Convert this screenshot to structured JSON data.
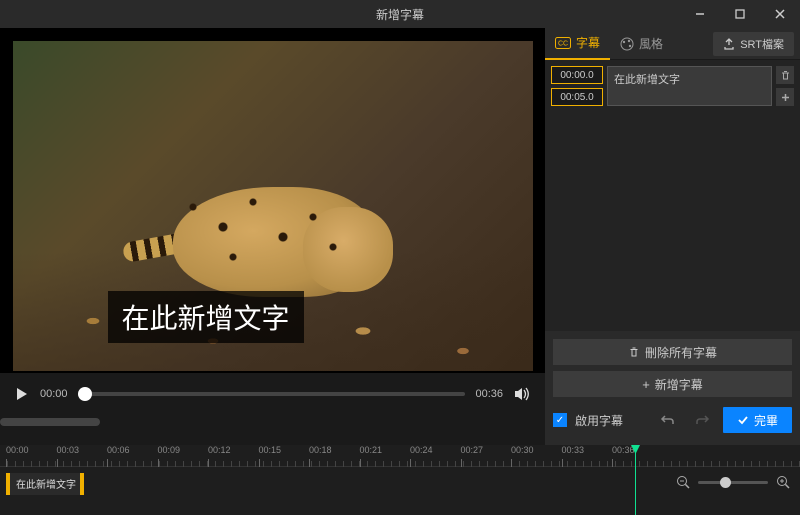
{
  "window": {
    "title": "新增字幕"
  },
  "tabs": {
    "subtitle": "字幕",
    "style": "風格",
    "srt": "SRT檔案"
  },
  "subtitle_entry": {
    "start": "00:00.0",
    "end": "00:05.0",
    "text": "在此新增文字"
  },
  "overlay_text": "在此新增文字",
  "player": {
    "current": "00:00",
    "duration": "00:36"
  },
  "actions": {
    "delete_all": "刪除所有字幕",
    "add_subtitle": "新增字幕",
    "enable": "啟用字幕",
    "done": "完畢"
  },
  "timeline": {
    "marks": [
      "00:00",
      "00:03",
      "00:06",
      "00:09",
      "00:12",
      "00:15",
      "00:18",
      "00:21",
      "00:24",
      "00:27",
      "00:30",
      "00:33",
      "00:36"
    ],
    "clip_label": "在此新增文字"
  }
}
